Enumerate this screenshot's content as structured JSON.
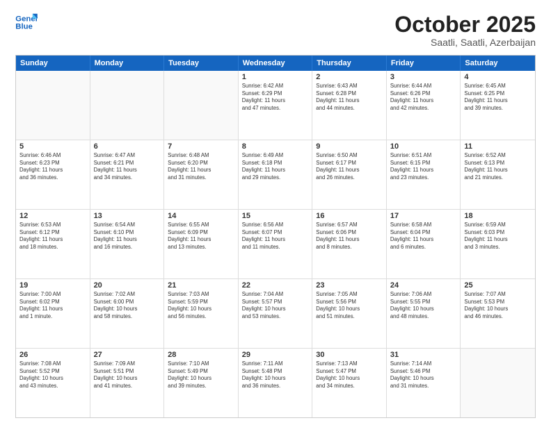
{
  "logo": {
    "line1": "General",
    "line2": "Blue"
  },
  "title": "October 2025",
  "subtitle": "Saatli, Saatli, Azerbaijan",
  "header": {
    "days": [
      "Sunday",
      "Monday",
      "Tuesday",
      "Wednesday",
      "Thursday",
      "Friday",
      "Saturday"
    ]
  },
  "weeks": [
    [
      {
        "day": "",
        "content": ""
      },
      {
        "day": "",
        "content": ""
      },
      {
        "day": "",
        "content": ""
      },
      {
        "day": "1",
        "content": "Sunrise: 6:42 AM\nSunset: 6:29 PM\nDaylight: 11 hours\nand 47 minutes."
      },
      {
        "day": "2",
        "content": "Sunrise: 6:43 AM\nSunset: 6:28 PM\nDaylight: 11 hours\nand 44 minutes."
      },
      {
        "day": "3",
        "content": "Sunrise: 6:44 AM\nSunset: 6:26 PM\nDaylight: 11 hours\nand 42 minutes."
      },
      {
        "day": "4",
        "content": "Sunrise: 6:45 AM\nSunset: 6:25 PM\nDaylight: 11 hours\nand 39 minutes."
      }
    ],
    [
      {
        "day": "5",
        "content": "Sunrise: 6:46 AM\nSunset: 6:23 PM\nDaylight: 11 hours\nand 36 minutes."
      },
      {
        "day": "6",
        "content": "Sunrise: 6:47 AM\nSunset: 6:21 PM\nDaylight: 11 hours\nand 34 minutes."
      },
      {
        "day": "7",
        "content": "Sunrise: 6:48 AM\nSunset: 6:20 PM\nDaylight: 11 hours\nand 31 minutes."
      },
      {
        "day": "8",
        "content": "Sunrise: 6:49 AM\nSunset: 6:18 PM\nDaylight: 11 hours\nand 29 minutes."
      },
      {
        "day": "9",
        "content": "Sunrise: 6:50 AM\nSunset: 6:17 PM\nDaylight: 11 hours\nand 26 minutes."
      },
      {
        "day": "10",
        "content": "Sunrise: 6:51 AM\nSunset: 6:15 PM\nDaylight: 11 hours\nand 23 minutes."
      },
      {
        "day": "11",
        "content": "Sunrise: 6:52 AM\nSunset: 6:13 PM\nDaylight: 11 hours\nand 21 minutes."
      }
    ],
    [
      {
        "day": "12",
        "content": "Sunrise: 6:53 AM\nSunset: 6:12 PM\nDaylight: 11 hours\nand 18 minutes."
      },
      {
        "day": "13",
        "content": "Sunrise: 6:54 AM\nSunset: 6:10 PM\nDaylight: 11 hours\nand 16 minutes."
      },
      {
        "day": "14",
        "content": "Sunrise: 6:55 AM\nSunset: 6:09 PM\nDaylight: 11 hours\nand 13 minutes."
      },
      {
        "day": "15",
        "content": "Sunrise: 6:56 AM\nSunset: 6:07 PM\nDaylight: 11 hours\nand 11 minutes."
      },
      {
        "day": "16",
        "content": "Sunrise: 6:57 AM\nSunset: 6:06 PM\nDaylight: 11 hours\nand 8 minutes."
      },
      {
        "day": "17",
        "content": "Sunrise: 6:58 AM\nSunset: 6:04 PM\nDaylight: 11 hours\nand 6 minutes."
      },
      {
        "day": "18",
        "content": "Sunrise: 6:59 AM\nSunset: 6:03 PM\nDaylight: 11 hours\nand 3 minutes."
      }
    ],
    [
      {
        "day": "19",
        "content": "Sunrise: 7:00 AM\nSunset: 6:02 PM\nDaylight: 11 hours\nand 1 minute."
      },
      {
        "day": "20",
        "content": "Sunrise: 7:02 AM\nSunset: 6:00 PM\nDaylight: 10 hours\nand 58 minutes."
      },
      {
        "day": "21",
        "content": "Sunrise: 7:03 AM\nSunset: 5:59 PM\nDaylight: 10 hours\nand 56 minutes."
      },
      {
        "day": "22",
        "content": "Sunrise: 7:04 AM\nSunset: 5:57 PM\nDaylight: 10 hours\nand 53 minutes."
      },
      {
        "day": "23",
        "content": "Sunrise: 7:05 AM\nSunset: 5:56 PM\nDaylight: 10 hours\nand 51 minutes."
      },
      {
        "day": "24",
        "content": "Sunrise: 7:06 AM\nSunset: 5:55 PM\nDaylight: 10 hours\nand 48 minutes."
      },
      {
        "day": "25",
        "content": "Sunrise: 7:07 AM\nSunset: 5:53 PM\nDaylight: 10 hours\nand 46 minutes."
      }
    ],
    [
      {
        "day": "26",
        "content": "Sunrise: 7:08 AM\nSunset: 5:52 PM\nDaylight: 10 hours\nand 43 minutes."
      },
      {
        "day": "27",
        "content": "Sunrise: 7:09 AM\nSunset: 5:51 PM\nDaylight: 10 hours\nand 41 minutes."
      },
      {
        "day": "28",
        "content": "Sunrise: 7:10 AM\nSunset: 5:49 PM\nDaylight: 10 hours\nand 39 minutes."
      },
      {
        "day": "29",
        "content": "Sunrise: 7:11 AM\nSunset: 5:48 PM\nDaylight: 10 hours\nand 36 minutes."
      },
      {
        "day": "30",
        "content": "Sunrise: 7:13 AM\nSunset: 5:47 PM\nDaylight: 10 hours\nand 34 minutes."
      },
      {
        "day": "31",
        "content": "Sunrise: 7:14 AM\nSunset: 5:46 PM\nDaylight: 10 hours\nand 31 minutes."
      },
      {
        "day": "",
        "content": ""
      }
    ]
  ]
}
